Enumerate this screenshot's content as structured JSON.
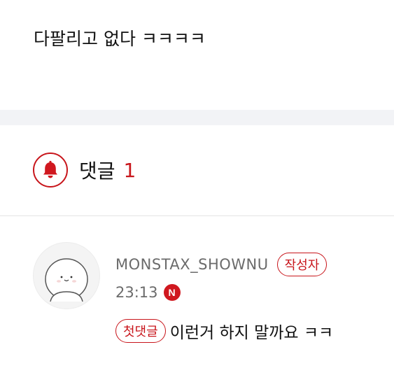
{
  "post": {
    "body_text": "다팔리고 없다 ㅋㅋㅋㅋ"
  },
  "comments": {
    "title": "댓글",
    "count": "1",
    "accent_color": "#c8151b"
  },
  "comment_list": [
    {
      "author": "MONSTAX_SHOWNU",
      "author_badge": "작성자",
      "time": "23:13",
      "new_badge": "N",
      "first_comment_badge": "첫댓글",
      "text": "이런거 하지 말까요 ㅋㅋ",
      "avatar_icon": "cartoon-face-avatar"
    }
  ]
}
